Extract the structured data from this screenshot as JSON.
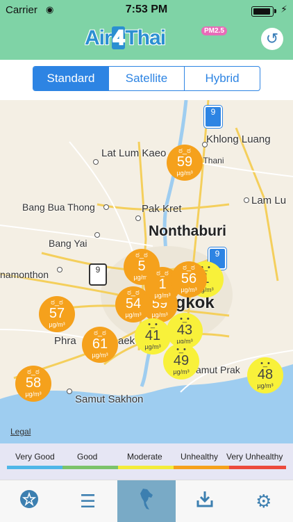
{
  "status": {
    "carrier": "Carrier",
    "time": "7:53 PM"
  },
  "app": {
    "logo_prefix": "Air",
    "logo_four": "4",
    "logo_suffix": "Thai",
    "pm_badge": "PM2.5"
  },
  "segments": {
    "items": [
      "Standard",
      "Satellite",
      "Hybrid"
    ],
    "selected": "Standard"
  },
  "map": {
    "places": [
      "Khlong Luang",
      "Lat Lum Kaeo",
      "Pathum Thani",
      "Bang Bua Thong",
      "Pak Kret",
      "Lam Lu",
      "Nonthaburi",
      "Bang Yai",
      "namonthon",
      "ngkok",
      "Phra",
      "aek",
      "amut Prak",
      "Samut Sakhon"
    ],
    "route_shields": [
      "9",
      "9",
      "9"
    ],
    "legal": "Legal",
    "unit": "µg/m³",
    "readings": [
      {
        "value": "59",
        "level": "unhealthy"
      },
      {
        "value": "57",
        "level": "unhealthy"
      },
      {
        "value": "5",
        "level": "unhealthy"
      },
      {
        "value": "54",
        "level": "unhealthy"
      },
      {
        "value": "59",
        "level": "unhealthy"
      },
      {
        "value": "1",
        "level": "unhealthy"
      },
      {
        "value": "56",
        "level": "unhealthy"
      },
      {
        "value": "1",
        "level": "moderate"
      },
      {
        "value": "61",
        "level": "unhealthy"
      },
      {
        "value": "41",
        "level": "moderate"
      },
      {
        "value": "43",
        "level": "moderate"
      },
      {
        "value": "49",
        "level": "moderate"
      },
      {
        "value": "58",
        "level": "unhealthy"
      },
      {
        "value": "48",
        "level": "moderate"
      }
    ]
  },
  "legend": {
    "items": [
      {
        "label": "Very Good",
        "color": "#4fb6e8"
      },
      {
        "label": "Good",
        "color": "#7cc36a"
      },
      {
        "label": "Moderate",
        "color": "#f3ec3a"
      },
      {
        "label": "Unhealthy",
        "color": "#f5a11c"
      },
      {
        "label": "Very Unhealthy",
        "color": "#ec4a3d"
      }
    ]
  },
  "tabs": [
    {
      "icon": "favorite-location-icon"
    },
    {
      "icon": "list-icon"
    },
    {
      "icon": "thailand-map-icon",
      "active": true
    },
    {
      "icon": "download-icon"
    },
    {
      "icon": "gear-icon"
    }
  ],
  "colors": {
    "header": "#7fd3a6",
    "accent": "#2d84e3",
    "unhealthy": "#f5a11c",
    "moderate": "#f8f13a"
  }
}
